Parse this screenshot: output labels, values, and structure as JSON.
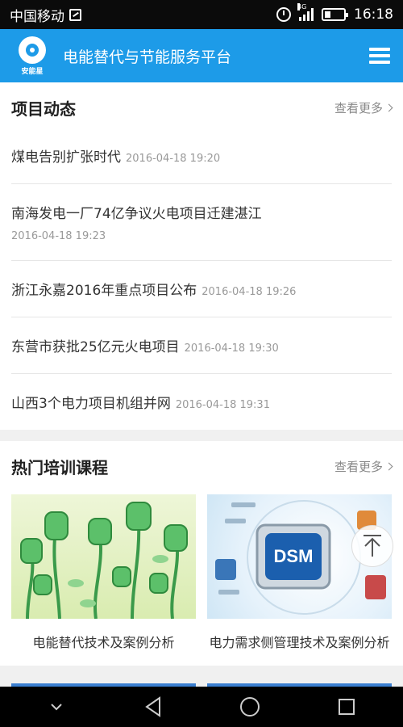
{
  "status": {
    "carrier": "中国移动",
    "network": "4G",
    "time": "16:18"
  },
  "app": {
    "logo_text": "安能星",
    "title": "电能替代与节能服务平台",
    "brand_color": "#1d9be8"
  },
  "project_news": {
    "title": "项目动态",
    "more_label": "查看更多",
    "items": [
      {
        "title": "煤电告别扩张时代",
        "date": "2016-04-18 19:20"
      },
      {
        "title": "南海发电一厂74亿争议火电项目迁建湛江",
        "date": "2016-04-18 19:23"
      },
      {
        "title": "浙江永嘉2016年重点项目公布",
        "date": "2016-04-18 19:26"
      },
      {
        "title": "东营市获批25亿元火电项目",
        "date": "2016-04-18 19:30"
      },
      {
        "title": "山西3个电力项目机组并网",
        "date": "2016-04-18 19:31"
      }
    ]
  },
  "courses": {
    "title": "热门培训课程",
    "more_label": "查看更多",
    "items": [
      {
        "title": "电能替代技术及案例分析"
      },
      {
        "title": "电力需求侧管理技术及案例分析",
        "badge": "DSM"
      }
    ]
  }
}
